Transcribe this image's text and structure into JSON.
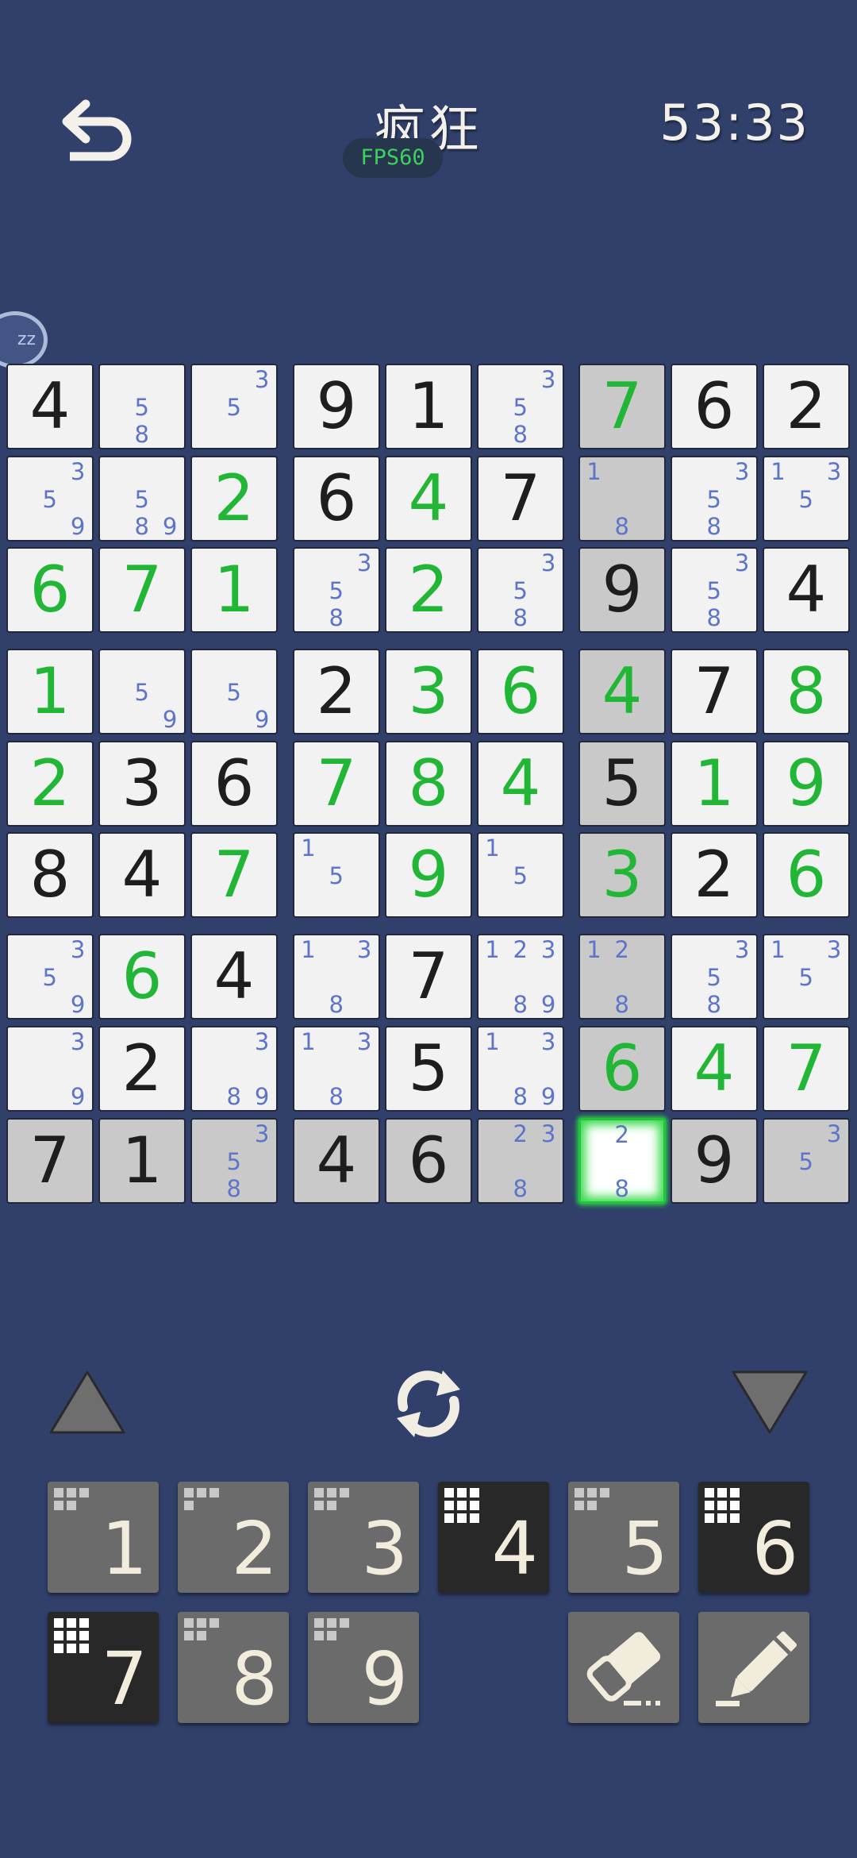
{
  "header": {
    "title": "疯狂",
    "fps": "FPS60",
    "timer": "53:33",
    "back_icon": "undo-arrow-icon"
  },
  "floating_ball": {
    "text": "zz"
  },
  "colors": {
    "background": "#30406a",
    "cell": "#f2f2f2",
    "cell_highlight": "#c9c9c9",
    "given_digit": "#1e1e1e",
    "user_digit": "#21b636",
    "note_digit": "#5d74c9",
    "selected_glow": "#3bdc4e",
    "pad_key": "#6b6b6b",
    "pad_key_completed": "#282828"
  },
  "board": {
    "selected": [
      8,
      6
    ],
    "highlight_rows": [
      8
    ],
    "highlight_cols": [
      6
    ],
    "cells": [
      [
        {
          "v": "4",
          "t": "g"
        },
        {
          "n": [
            5,
            8
          ]
        },
        {
          "n": [
            3,
            5
          ]
        },
        {
          "v": "9",
          "t": "g"
        },
        {
          "v": "1",
          "t": "g"
        },
        {
          "n": [
            3,
            5,
            8
          ]
        },
        {
          "v": "7",
          "t": "u"
        },
        {
          "v": "6",
          "t": "g"
        },
        {
          "v": "2",
          "t": "g"
        }
      ],
      [
        {
          "n": [
            3,
            5,
            9
          ]
        },
        {
          "n": [
            5,
            8,
            9
          ]
        },
        {
          "v": "2",
          "t": "u"
        },
        {
          "v": "6",
          "t": "g"
        },
        {
          "v": "4",
          "t": "u"
        },
        {
          "v": "7",
          "t": "g"
        },
        {
          "n": [
            1,
            8
          ]
        },
        {
          "n": [
            3,
            5,
            8
          ]
        },
        {
          "n": [
            1,
            3,
            5
          ]
        }
      ],
      [
        {
          "v": "6",
          "t": "u"
        },
        {
          "v": "7",
          "t": "u"
        },
        {
          "v": "1",
          "t": "u"
        },
        {
          "n": [
            3,
            5,
            8
          ]
        },
        {
          "v": "2",
          "t": "u"
        },
        {
          "n": [
            3,
            5,
            8
          ]
        },
        {
          "v": "9",
          "t": "g"
        },
        {
          "n": [
            3,
            5,
            8
          ]
        },
        {
          "v": "4",
          "t": "g"
        }
      ],
      [
        {
          "v": "1",
          "t": "u"
        },
        {
          "n": [
            5,
            9
          ]
        },
        {
          "n": [
            5,
            9
          ]
        },
        {
          "v": "2",
          "t": "g"
        },
        {
          "v": "3",
          "t": "u"
        },
        {
          "v": "6",
          "t": "u"
        },
        {
          "v": "4",
          "t": "u"
        },
        {
          "v": "7",
          "t": "g"
        },
        {
          "v": "8",
          "t": "u"
        }
      ],
      [
        {
          "v": "2",
          "t": "u"
        },
        {
          "v": "3",
          "t": "g"
        },
        {
          "v": "6",
          "t": "g"
        },
        {
          "v": "7",
          "t": "u"
        },
        {
          "v": "8",
          "t": "u"
        },
        {
          "v": "4",
          "t": "u"
        },
        {
          "v": "5",
          "t": "g"
        },
        {
          "v": "1",
          "t": "u"
        },
        {
          "v": "9",
          "t": "u"
        }
      ],
      [
        {
          "v": "8",
          "t": "g"
        },
        {
          "v": "4",
          "t": "g"
        },
        {
          "v": "7",
          "t": "u"
        },
        {
          "n": [
            1,
            5
          ]
        },
        {
          "v": "9",
          "t": "u"
        },
        {
          "n": [
            1,
            5
          ]
        },
        {
          "v": "3",
          "t": "u"
        },
        {
          "v": "2",
          "t": "g"
        },
        {
          "v": "6",
          "t": "u"
        }
      ],
      [
        {
          "n": [
            3,
            5,
            9
          ]
        },
        {
          "v": "6",
          "t": "u"
        },
        {
          "v": "4",
          "t": "g"
        },
        {
          "n": [
            1,
            3,
            8
          ]
        },
        {
          "v": "7",
          "t": "g"
        },
        {
          "n": [
            1,
            2,
            3,
            8,
            9
          ]
        },
        {
          "n": [
            1,
            2,
            8
          ]
        },
        {
          "n": [
            3,
            5,
            8
          ]
        },
        {
          "n": [
            1,
            3,
            5
          ]
        }
      ],
      [
        {
          "n": [
            3,
            9
          ]
        },
        {
          "v": "2",
          "t": "g"
        },
        {
          "n": [
            3,
            8,
            9
          ]
        },
        {
          "n": [
            1,
            3,
            8
          ]
        },
        {
          "v": "5",
          "t": "g"
        },
        {
          "n": [
            1,
            3,
            8,
            9
          ]
        },
        {
          "v": "6",
          "t": "u"
        },
        {
          "v": "4",
          "t": "u"
        },
        {
          "v": "7",
          "t": "u"
        }
      ],
      [
        {
          "v": "7",
          "t": "g"
        },
        {
          "v": "1",
          "t": "g"
        },
        {
          "n": [
            3,
            5,
            8
          ]
        },
        {
          "v": "4",
          "t": "g"
        },
        {
          "v": "6",
          "t": "g"
        },
        {
          "n": [
            2,
            3,
            8
          ]
        },
        {
          "n": [
            2,
            8
          ]
        },
        {
          "v": "9",
          "t": "g"
        },
        {
          "n": [
            3,
            5
          ]
        }
      ]
    ]
  },
  "controls": {
    "up_icon": "triangle-up-icon",
    "rotate_icon": "rotate-arrows-icon",
    "down_icon": "triangle-down-icon"
  },
  "numpad": {
    "keys": [
      {
        "label": "1",
        "completed": false,
        "remaining": 5
      },
      {
        "label": "2",
        "completed": false,
        "remaining": 4
      },
      {
        "label": "3",
        "completed": false,
        "remaining": 5
      },
      {
        "label": "4",
        "completed": true,
        "remaining": 9
      },
      {
        "label": "5",
        "completed": false,
        "remaining": 5
      },
      {
        "label": "6",
        "completed": true,
        "remaining": 9
      },
      {
        "label": "7",
        "completed": true,
        "remaining": 9
      },
      {
        "label": "8",
        "completed": false,
        "remaining": 5
      },
      {
        "label": "9",
        "completed": false,
        "remaining": 5
      }
    ],
    "eraser_icon": "eraser-icon",
    "pencil_icon": "pencil-icon"
  }
}
